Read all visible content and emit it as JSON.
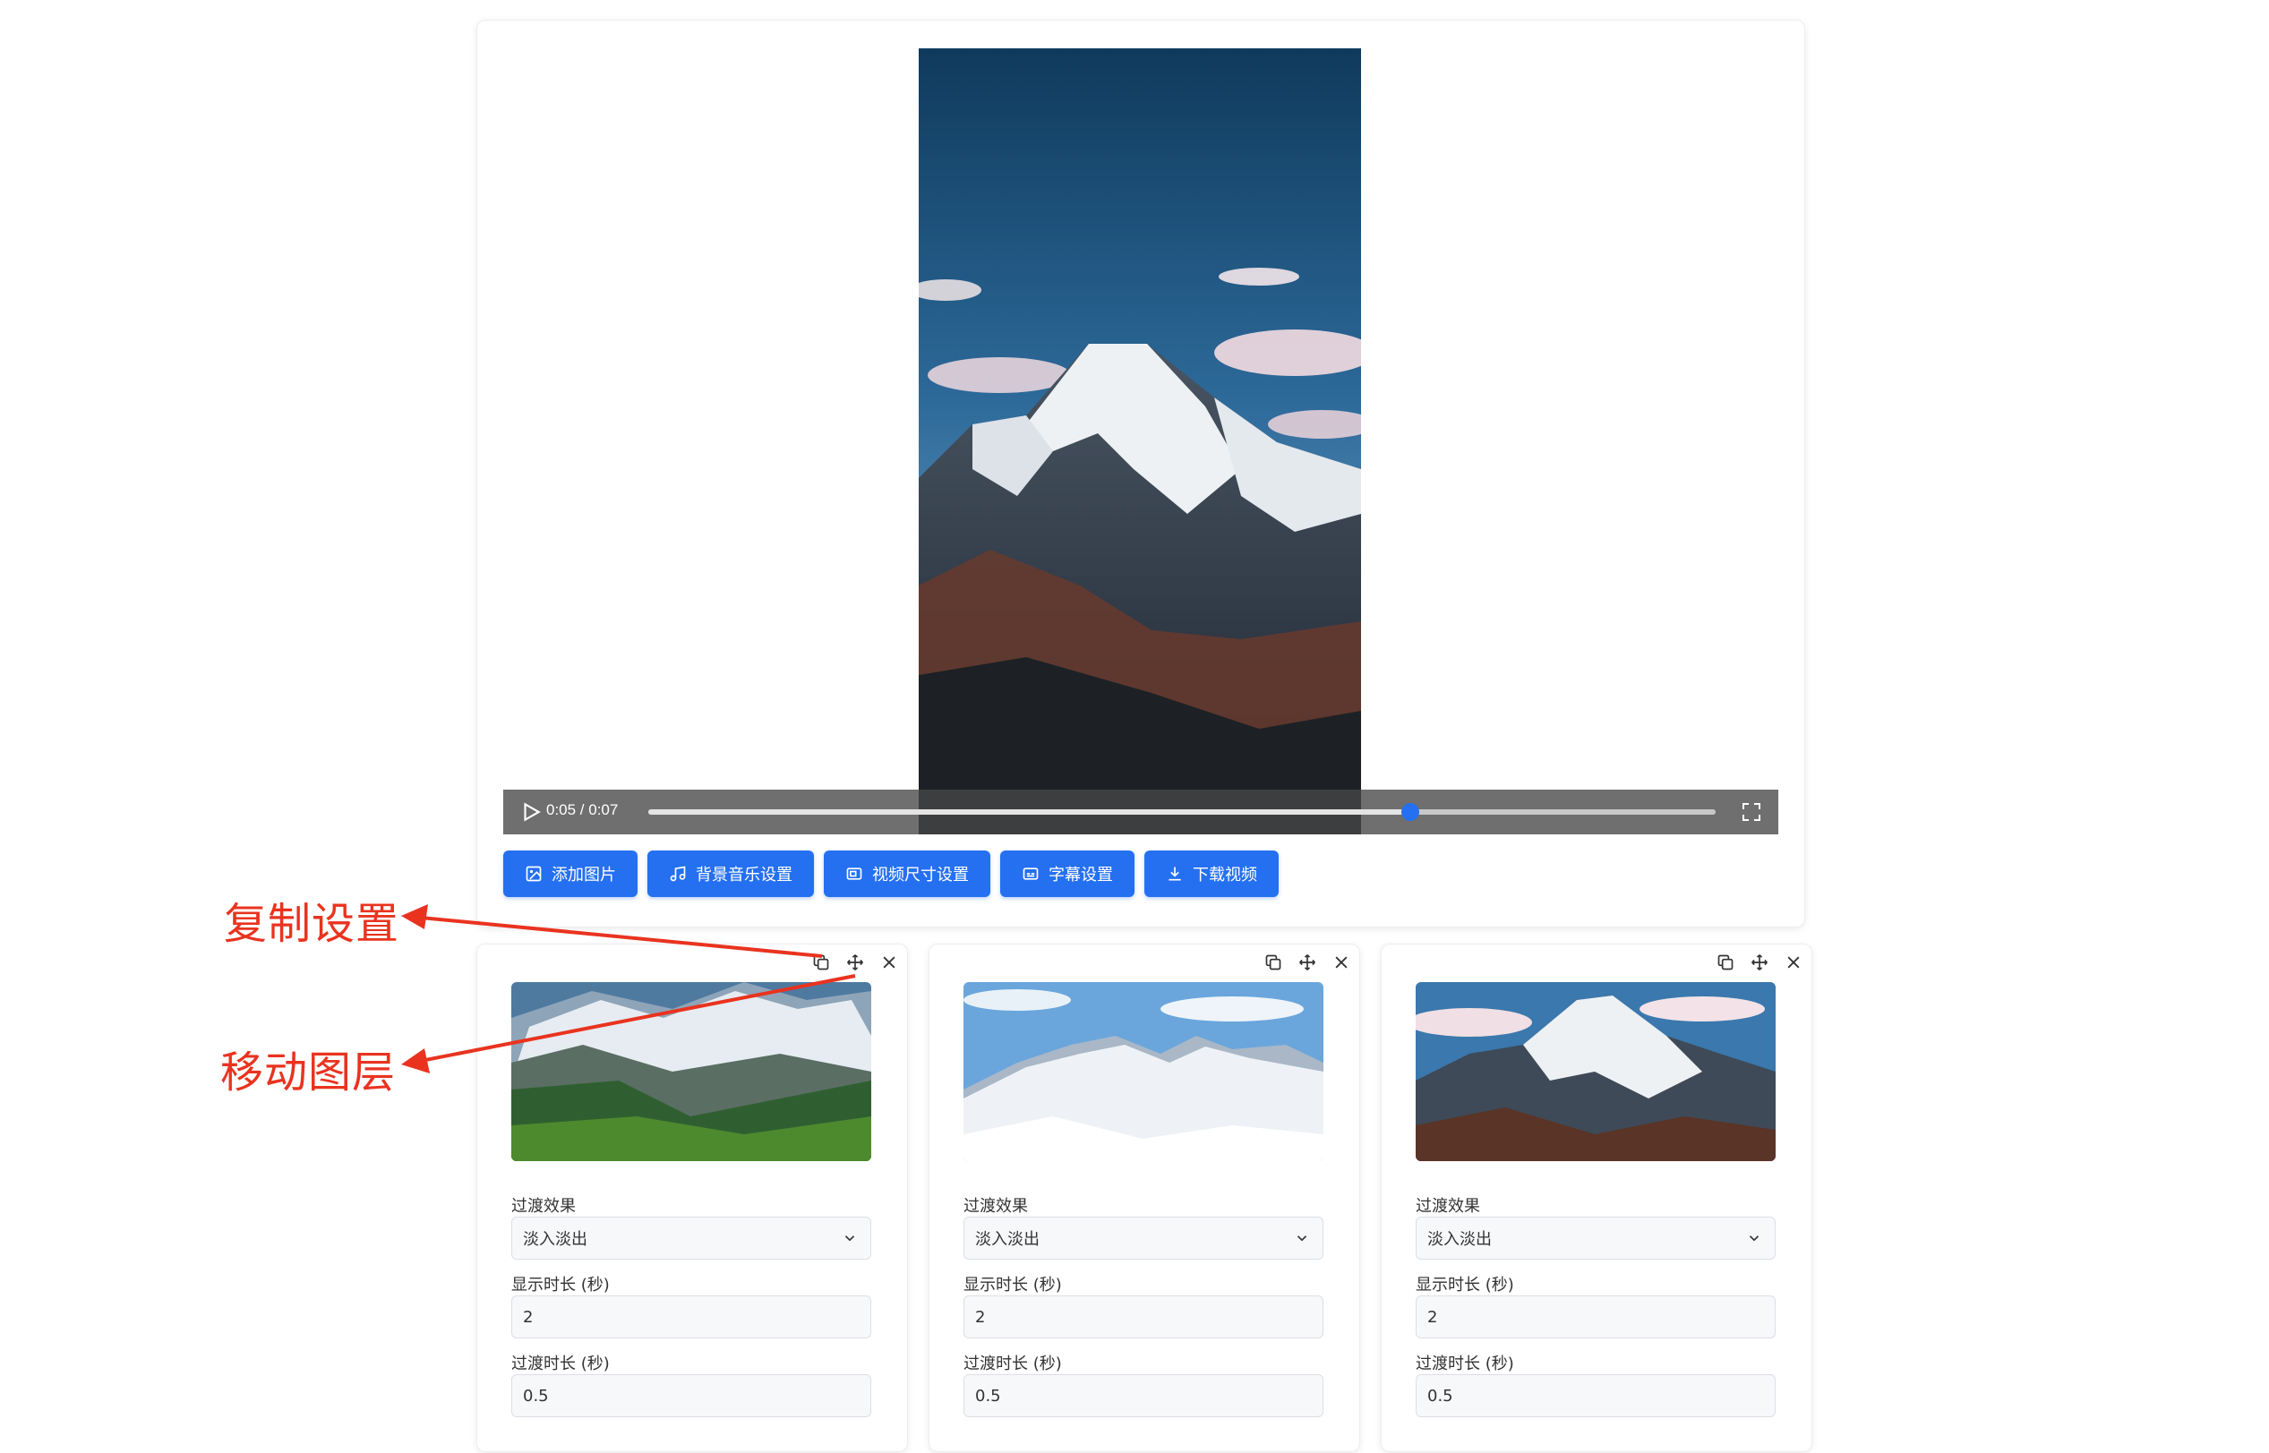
{
  "player": {
    "time_display": "0:05 / 0:07",
    "progress": 0.714,
    "accent_color": "#2570f0"
  },
  "toolbar": {
    "buttons": [
      {
        "label": "添加图片",
        "icon": "add-image-icon"
      },
      {
        "label": "背景音乐设置",
        "icon": "music-icon"
      },
      {
        "label": "视频尺寸设置",
        "icon": "resize-icon"
      },
      {
        "label": "字幕设置",
        "icon": "subtitles-icon"
      },
      {
        "label": "下载视频",
        "icon": "download-icon"
      }
    ]
  },
  "layers": [
    {
      "transition_label": "过渡效果",
      "transition_value": "淡入淡出",
      "duration_label": "显示时长 (秒)",
      "duration_value": "2",
      "transition_duration_label": "过渡时长 (秒)",
      "transition_duration_value": "0.5"
    },
    {
      "transition_label": "过渡效果",
      "transition_value": "淡入淡出",
      "duration_label": "显示时长 (秒)",
      "duration_value": "2",
      "transition_duration_label": "过渡时长 (秒)",
      "transition_duration_value": "0.5"
    },
    {
      "transition_label": "过渡效果",
      "transition_value": "淡入淡出",
      "duration_label": "显示时长 (秒)",
      "duration_value": "2",
      "transition_duration_label": "过渡时长 (秒)",
      "transition_duration_value": "0.5"
    }
  ],
  "annotations": {
    "copy_settings": "复制设置",
    "move_layer": "移动图层",
    "color": "#e9331f"
  }
}
